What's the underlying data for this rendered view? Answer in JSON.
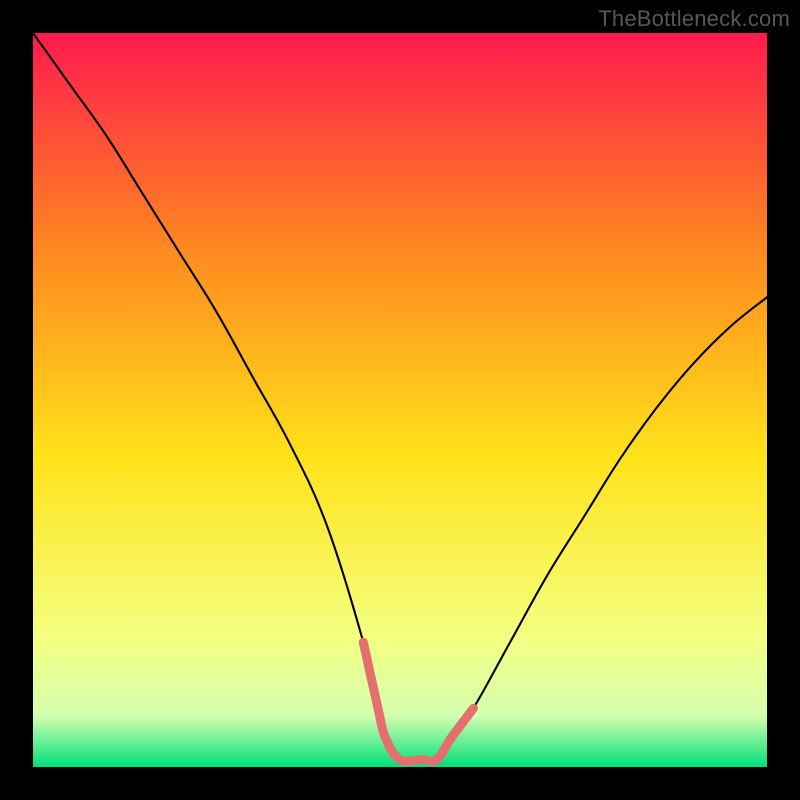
{
  "watermark": "TheBottleneck.com",
  "chart_data": {
    "type": "line",
    "title": "",
    "xlabel": "",
    "ylabel": "",
    "xlim": [
      0,
      100
    ],
    "ylim": [
      0,
      100
    ],
    "grid": false,
    "legend": false,
    "gradient_colors": {
      "top": "#FF1A4E",
      "upper_mid": "#FF8A1F",
      "mid": "#FFE31A",
      "lower_mid": "#F4FF80",
      "near_bottom": "#D5FFB0",
      "bottom": "#00E07A"
    },
    "series": [
      {
        "name": "bottleneck-curve",
        "stroke": "#000000",
        "x": [
          0,
          5,
          10,
          15,
          20,
          25,
          30,
          35,
          40,
          45,
          47,
          48,
          50,
          53,
          55,
          57,
          60,
          65,
          70,
          75,
          80,
          85,
          90,
          95,
          100
        ],
        "y": [
          100,
          93,
          86,
          78,
          70,
          62,
          53,
          44,
          33,
          17,
          8,
          4,
          1,
          1,
          1,
          4,
          8,
          17,
          26,
          34,
          42,
          49,
          55,
          60,
          64
        ]
      },
      {
        "name": "optimal-region-highlight",
        "stroke": "#E36F6F",
        "x": [
          45,
          47,
          48,
          50,
          53,
          55,
          57,
          60
        ],
        "y": [
          17,
          8,
          4,
          1,
          1,
          1,
          4,
          8
        ]
      }
    ],
    "annotations": []
  }
}
